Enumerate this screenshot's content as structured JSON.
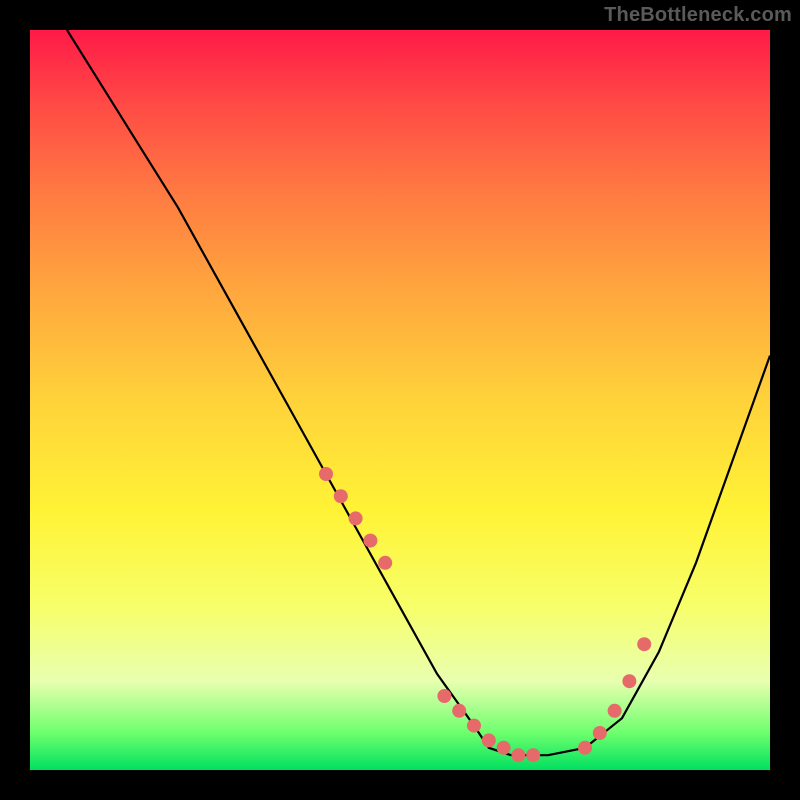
{
  "watermark": "TheBottleneck.com",
  "chart_data": {
    "type": "line",
    "title": "",
    "xlabel": "",
    "ylabel": "",
    "xlim": [
      0,
      100
    ],
    "ylim": [
      0,
      100
    ],
    "series": [
      {
        "name": "curve",
        "x": [
          5,
          10,
          15,
          20,
          25,
          30,
          35,
          40,
          45,
          50,
          55,
          60,
          62,
          65,
          70,
          75,
          80,
          85,
          90,
          95,
          100
        ],
        "y": [
          100,
          92,
          84,
          76,
          67,
          58,
          49,
          40,
          31,
          22,
          13,
          6,
          3,
          2,
          2,
          3,
          7,
          16,
          28,
          42,
          56
        ]
      }
    ],
    "markers": {
      "name": "highlight-points",
      "color": "#e66a6a",
      "x": [
        40,
        42,
        44,
        46,
        48,
        56,
        58,
        60,
        62,
        64,
        66,
        68,
        75,
        77,
        79,
        81,
        83
      ],
      "y": [
        40,
        37,
        34,
        31,
        28,
        10,
        8,
        6,
        4,
        3,
        2,
        2,
        3,
        5,
        8,
        12,
        17
      ]
    }
  },
  "colors": {
    "marker": "#e66a6a",
    "curve": "#000000",
    "background_top": "#ff1a48",
    "background_bottom": "#00e060"
  }
}
